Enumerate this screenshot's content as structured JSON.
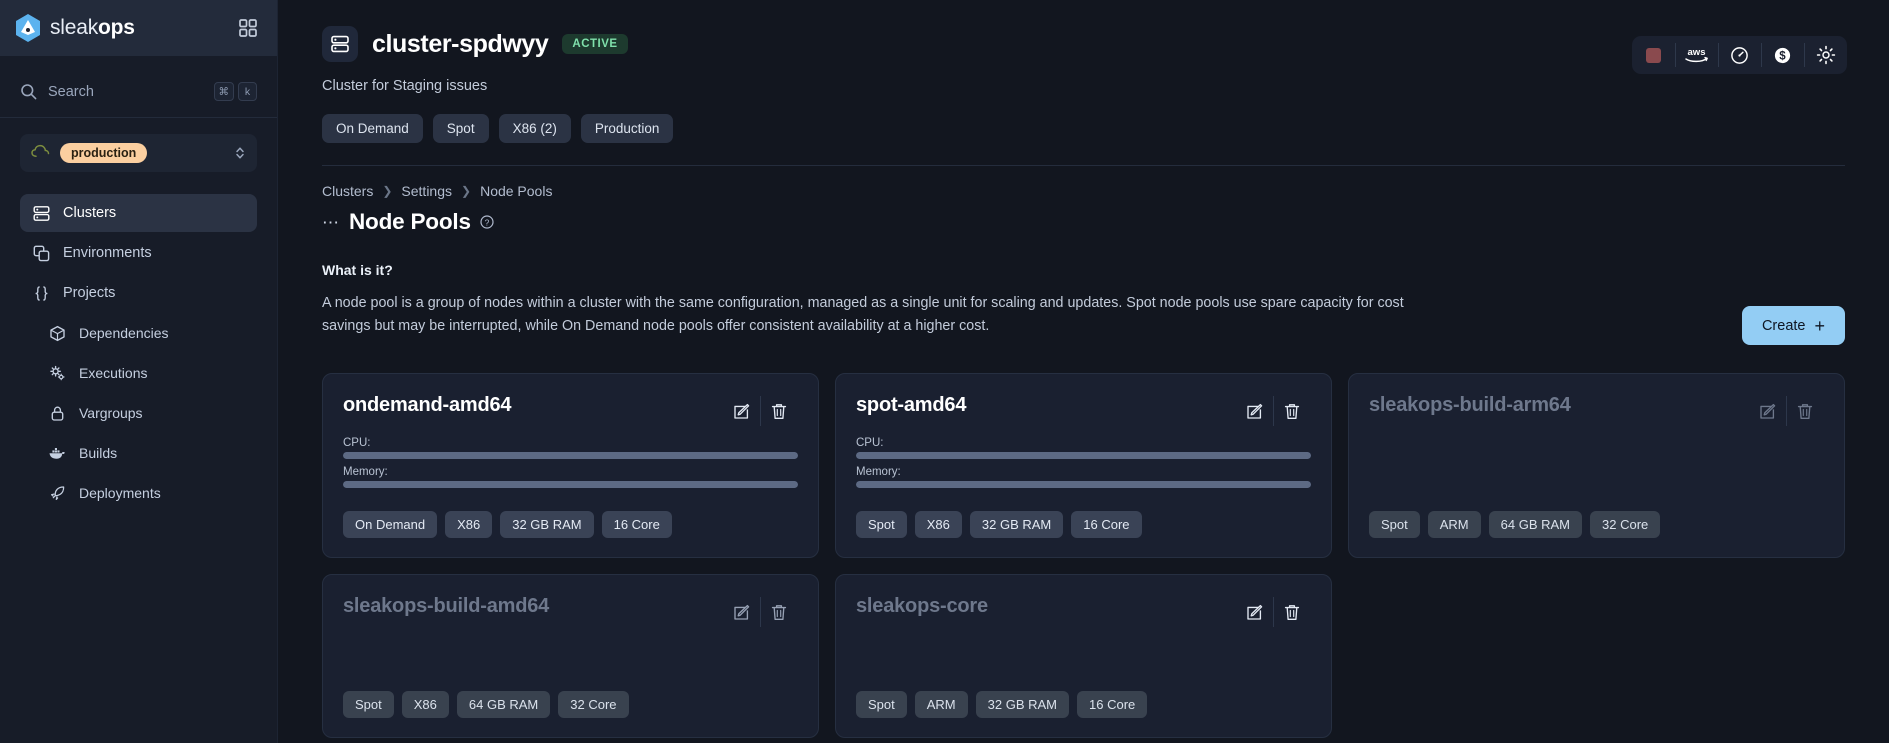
{
  "sidebar": {
    "brand": {
      "name_light": "sleak",
      "name_bold": "ops",
      "logo_icon": "sleakops-logo-icon"
    },
    "grid_icon": "grid-apps-icon",
    "search": {
      "placeholder": "Search",
      "icon": "search-icon",
      "kbd_cmd": "⌘",
      "kbd_key": "k"
    },
    "environment": {
      "label": "production",
      "icon": "cloud-icon",
      "caret_icon": "chevron-updown-icon"
    },
    "items": [
      {
        "label": "Clusters",
        "icon": "server-stack-icon",
        "active": true,
        "indent": false
      },
      {
        "label": "Environments",
        "icon": "copy-layers-icon",
        "active": false,
        "indent": false
      },
      {
        "label": "Projects",
        "icon": "braces-icon",
        "active": false,
        "indent": false
      },
      {
        "label": "Dependencies",
        "icon": "cube-icon",
        "active": false,
        "indent": true
      },
      {
        "label": "Executions",
        "icon": "gears-icon",
        "active": false,
        "indent": true
      },
      {
        "label": "Vargroups",
        "icon": "lock-icon",
        "active": false,
        "indent": true
      },
      {
        "label": "Builds",
        "icon": "docker-whale-icon",
        "active": false,
        "indent": true
      },
      {
        "label": "Deployments",
        "icon": "rocket-icon",
        "active": false,
        "indent": true
      }
    ]
  },
  "header": {
    "cluster_icon": "server-stack-icon",
    "title": "cluster-spdwyy",
    "status": "ACTIVE",
    "subtitle": "Cluster for Staging issues",
    "chips": [
      "On Demand",
      "Spot",
      "X86 (2)",
      "Production"
    ],
    "toolbar_icons": [
      {
        "name": "status-square-indicator",
        "glyph": "square",
        "color": "#8a4a4e"
      },
      {
        "name": "aws-provider-icon",
        "glyph": "aws"
      },
      {
        "name": "gauge-icon",
        "glyph": "gauge"
      },
      {
        "name": "billing-dollar-icon",
        "glyph": "dollar"
      },
      {
        "name": "gear-settings-icon",
        "glyph": "gear"
      }
    ]
  },
  "breadcrumb": [
    "Clusters",
    "Settings",
    "Node Pools"
  ],
  "page": {
    "dots_icon": "drag-dots-icon",
    "title": "Node Pools",
    "help_icon": "help-circle-icon",
    "whatis_label": "What is it?",
    "description": "A node pool is a group of nodes within a cluster with the same configuration, managed as a single unit for scaling and updates. Spot node pools use spare capacity for cost savings but may be interrupted, while On Demand node pools offer consistent availability at a higher cost.",
    "create_label": "Create",
    "create_icon": "plus-icon",
    "create_color": "#93cdf4"
  },
  "node_pools": [
    {
      "name": "ondemand-amd64",
      "dimmed": false,
      "metrics": [
        {
          "label": "CPU:",
          "percent": 100
        },
        {
          "label": "Memory:",
          "percent": 100
        }
      ],
      "chips": [
        "On Demand",
        "X86",
        "32 GB RAM",
        "16 Core"
      ],
      "edit_icon": "edit-pencil-icon",
      "delete_icon": "trash-icon"
    },
    {
      "name": "spot-amd64",
      "dimmed": false,
      "metrics": [
        {
          "label": "CPU:",
          "percent": 100
        },
        {
          "label": "Memory:",
          "percent": 100
        }
      ],
      "chips": [
        "Spot",
        "X86",
        "32 GB RAM",
        "16 Core"
      ],
      "edit_icon": "edit-pencil-icon",
      "delete_icon": "trash-icon"
    },
    {
      "name": "sleakops-build-arm64",
      "dimmed": true,
      "metrics": [],
      "chips": [
        "Spot",
        "ARM",
        "64 GB RAM",
        "32 Core"
      ],
      "edit_icon": "edit-pencil-icon",
      "delete_icon": "trash-icon"
    },
    {
      "name": "sleakops-build-amd64",
      "dimmed": true,
      "metrics": [],
      "chips": [
        "Spot",
        "X86",
        "64 GB RAM",
        "32 Core"
      ],
      "edit_icon": "edit-pencil-icon",
      "delete_icon": "trash-icon"
    },
    {
      "name": "sleakops-core",
      "dimmed": true,
      "metrics": [],
      "chips": [
        "Spot",
        "ARM",
        "32 GB RAM",
        "16 Core"
      ],
      "edit_icon": "edit-pencil-icon",
      "delete_icon": "trash-icon"
    }
  ]
}
